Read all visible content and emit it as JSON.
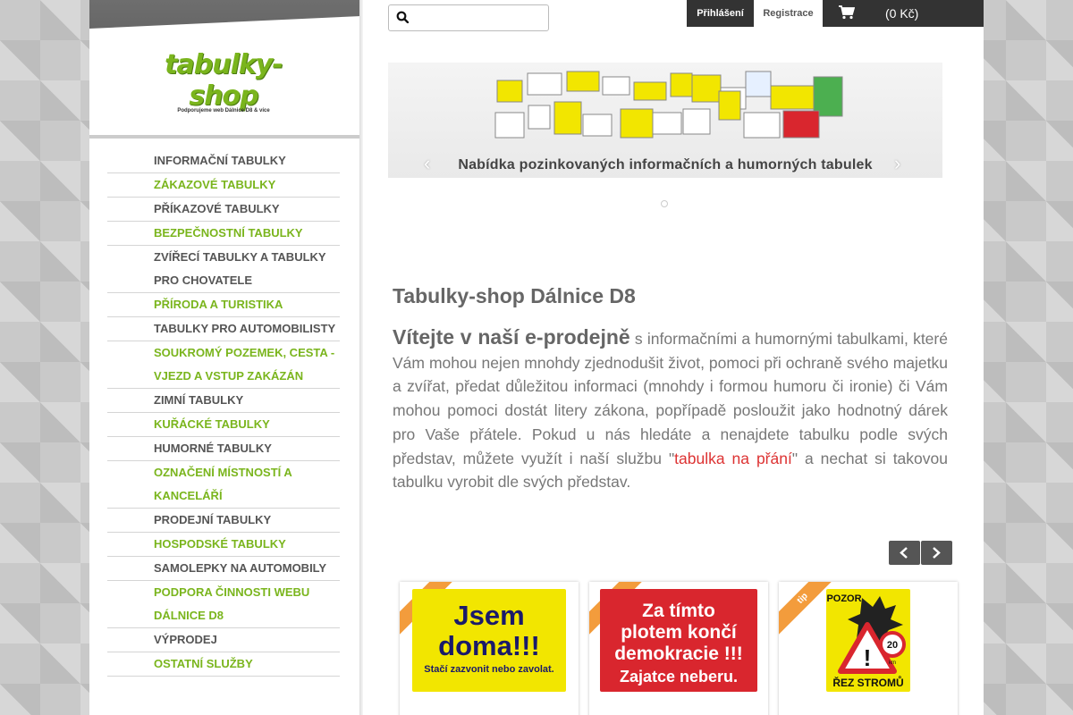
{
  "logo": {
    "name": "tabulky-shop",
    "tagline": "Podporujeme web Dálnice D8 & více"
  },
  "menu": [
    {
      "label": "INFORMAČNÍ TABULKY",
      "color": "#555555"
    },
    {
      "label": "ZÁKAZOVÉ TABULKY",
      "color": "#7ab51d"
    },
    {
      "label": "PŘÍKAZOVÉ TABULKY",
      "color": "#555555"
    },
    {
      "label": "BEZPEČNOSTNÍ TABULKY",
      "color": "#7ab51d"
    },
    {
      "label": "ZVÍŘECÍ TABULKY A TABULKY PRO CHOVATELE",
      "color": "#555555"
    },
    {
      "label": "PŘÍRODA A TURISTIKA",
      "color": "#7ab51d"
    },
    {
      "label": "TABULKY PRO AUTOMOBILISTY",
      "color": "#555555"
    },
    {
      "label": "SOUKROMÝ POZEMEK, CESTA - VJEZD A VSTUP ZAKÁZÁN",
      "color": "#7ab51d"
    },
    {
      "label": "ZIMNÍ TABULKY",
      "color": "#555555"
    },
    {
      "label": "KUŘÁCKÉ TABULKY",
      "color": "#7ab51d"
    },
    {
      "label": "HUMORNÉ TABULKY",
      "color": "#555555"
    },
    {
      "label": "OZNAČENÍ MÍSTNOSTÍ A KANCELÁŘÍ",
      "color": "#7ab51d"
    },
    {
      "label": "PRODEJNÍ TABULKY",
      "color": "#555555"
    },
    {
      "label": "HOSPODSKÉ TABULKY",
      "color": "#7ab51d"
    },
    {
      "label": "SAMOLEPKY NA AUTOMOBILY",
      "color": "#555555"
    },
    {
      "label": "PODPORA ČINNOSTI WEBU DÁLNICE D8",
      "color": "#7ab51d"
    },
    {
      "label": "VÝPRODEJ",
      "color": "#555555"
    },
    {
      "label": "OSTATNÍ SLUŽBY",
      "color": "#7ab51d"
    }
  ],
  "topbar": {
    "search_placeholder": "",
    "login_label": "Přihlášení",
    "register_label": "Registrace",
    "cart_label": "(0 Kč)"
  },
  "banner": {
    "caption": "Nabídka pozinkovaných informačních a humorných tabulek",
    "prev": "‹",
    "next": "›"
  },
  "content": {
    "title": "Tabulky-shop Dálnice D8",
    "lead": "Vítejte v naší e-prodejně",
    "lead_rest": " s informačními",
    "para_1": "a humornými tabulkami, které Vám mohou nejen mnohdy zjednodušit život, pomoci při ochraně svého majetku a zvířat, předat důležitou informaci (mnohdy i formou humoru či ironie) či Vám mohou pomoci dostát litery zákona, popřípadě posloužit jako hodnotný dárek pro Vaše přátele. Pokud u nás hledáte a nenajdete tabulku podle svých představ, můžete využít i naší službu \"",
    "link": "tabulka na přání",
    "para_2": "\" a nechat si takovou tabulku vyrobit dle svých představ."
  },
  "products": [
    {
      "badge": "tip",
      "sign_line1": "Jsem",
      "sign_line2": "doma!!!",
      "sign_sub": "Stačí zazvonit nebo zavolat.",
      "bg": "#f2e600",
      "fg": "#1a1a6a"
    },
    {
      "badge": "tip",
      "sign_line1": "Za tímto",
      "sign_line2": "plotem končí",
      "sign_line3": "demokracie !!!",
      "sign_sub": "Zajatce neberu.",
      "bg": "#d9262e",
      "fg": "#ffffff"
    },
    {
      "badge": "tip",
      "sign_top": "POZOR",
      "sign_speed": "20",
      "sign_unit": "km",
      "sign_bottom": "ŘEZ STROMŮ",
      "bg": "#f2e600",
      "fg": "#111111"
    }
  ],
  "colors": {
    "accent": "#7ab51d",
    "link": "#dd3333",
    "tip": "#f39c3c"
  }
}
